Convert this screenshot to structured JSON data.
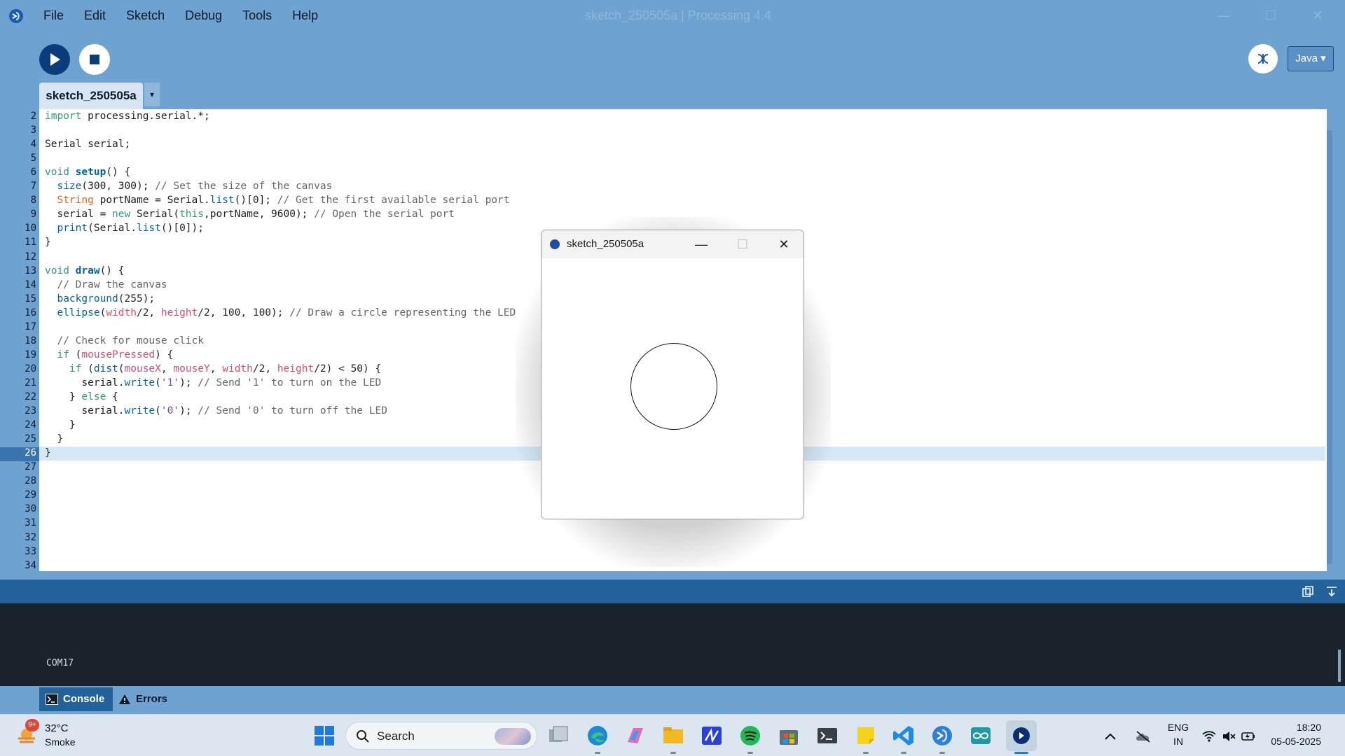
{
  "window": {
    "title": "sketch_250505a | Processing 4.4",
    "controls": {
      "minimize": "—",
      "maximize": "☐",
      "close": "✕"
    }
  },
  "menu": [
    "File",
    "Edit",
    "Sketch",
    "Debug",
    "Tools",
    "Help"
  ],
  "toolbar": {
    "run_icon": "play-icon",
    "stop_icon": "stop-icon",
    "debugger_icon": "butterfly-icon",
    "mode_label": "Java ▾"
  },
  "tabs": [
    {
      "label": "sketch_250505a",
      "active": true
    }
  ],
  "tab_menu_label": "▾",
  "editor": {
    "current_line": 26,
    "line_numbers": [
      "2",
      "3",
      "4",
      "5",
      "6",
      "7",
      "8",
      "9",
      "10",
      "11",
      "12",
      "13",
      "14",
      "15",
      "16",
      "17",
      "18",
      "19",
      "20",
      "21",
      "22",
      "23",
      "24",
      "25",
      "26",
      "27",
      "28",
      "29",
      "30",
      "31",
      "32",
      "33",
      "34"
    ],
    "code": [
      "import processing.serial.*;",
      "",
      "Serial serial;",
      "",
      "void setup() {",
      "  size(300, 300); // Set the size of the canvas",
      "  String portName = Serial.list()[0]; // Get the first available serial port",
      "  serial = new Serial(this,portName, 9600); // Open the serial port",
      "  print(Serial.list()[0]);",
      "}",
      "",
      "void draw() {",
      "  // Draw the canvas",
      "  background(255);",
      "  ellipse(width/2, height/2, 100, 100); // Draw a circle representing the LED",
      "",
      "  // Check for mouse click",
      "  if (mousePressed) {",
      "    if (dist(mouseX, mouseY, width/2, height/2) < 50) {",
      "      serial.write('1'); // Send '1' to turn on the LED",
      "    } else {",
      "      serial.write('0'); // Send '0' to turn off the LED",
      "    }",
      "  }",
      "}"
    ]
  },
  "console": {
    "output": "COM17",
    "tabs": [
      {
        "label": "Console",
        "icon": "terminal-icon",
        "active": true
      },
      {
        "label": "Errors",
        "icon": "warning-icon",
        "active": false
      }
    ],
    "header_icons": [
      "clipboard-copy-icon",
      "collapse-down-icon"
    ]
  },
  "sketch_window": {
    "title": "sketch_250505a",
    "controls": {
      "minimize": "—",
      "maximize": "☐",
      "close": "✕"
    }
  },
  "taskbar": {
    "weather": {
      "temp": "32°C",
      "desc": "Smoke",
      "badge": "9+"
    },
    "search_placeholder": "Search",
    "apps": [
      "windows-start-icon",
      "task-view-icon",
      "edge-icon",
      "copilot-icon",
      "file-explorer-icon",
      "app-icon",
      "spotify-icon",
      "store-icon",
      "terminal-icon",
      "sticky-notes-icon",
      "vscode-icon",
      "processing-icon",
      "arduino-icon",
      "processing-sketch-icon"
    ],
    "tray": {
      "lang_top": "ENG",
      "lang_bottom": "IN",
      "time": "18:20",
      "date": "05-05-2025"
    }
  },
  "colors": {
    "chrome": "#6ea2d0",
    "run_button": "#0b3d7a",
    "console_bg": "#1a222c",
    "console_head": "#24629c",
    "current_line": "#d6e8f8"
  }
}
